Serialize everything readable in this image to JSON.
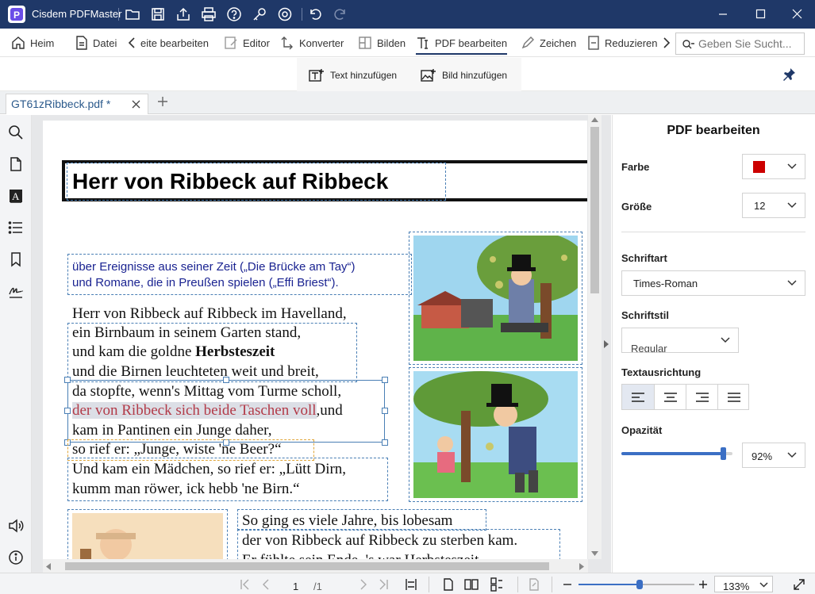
{
  "app": {
    "title": "Cisdem PDFMaster",
    "accent_color": "#1f3868"
  },
  "menu": {
    "home": "Heim",
    "file": "Datei",
    "edit_page": "eite bearbeiten",
    "editor": "Editor",
    "converter": "Konverter",
    "images": "Bilden",
    "edit_pdf": "PDF bearbeiten",
    "sign": "Zeichen",
    "reduce": "Reduzieren"
  },
  "search": {
    "placeholder": "Geben Sie Sucht..."
  },
  "subtoolbar": {
    "add_text": "Text hinzufügen",
    "add_image": "Bild hinzufügen"
  },
  "tab": {
    "filename": "GT61zRibbeck.pdf *"
  },
  "document": {
    "heading": "Herr von Ribbeck auf Ribbeck",
    "intro_line1": "über Ereignisse aus seiner Zeit („Die Brücke am Tay“)",
    "intro_line2": "und Romane, die in Preußen spielen („Effi Briest“).",
    "p1": "Herr von Ribbeck auf Ribbeck im Havelland,",
    "p2": "ein Birnbaum in seinem Garten stand,",
    "p3a": "und kam die goldne ",
    "p3b": "Herbsteszeit",
    "p4": "und die Birnen leuchteten weit und breit,",
    "p5": "da stopfte, wenn's Mittag vom Turme scholl,",
    "p6a": "der von Ribbeck sich beide Taschen voll",
    "p6b": ",und",
    "p7": "kam in Pantinen ein Junge daher,",
    "p8": "so rief er: „Junge, wiste 'ne Beer?“",
    "p9": "Und kam ein Mädchen, so rief er: „Lütt Dirn,",
    "p10": "kumm man röwer, ick hebb 'ne Birn.“",
    "p11": "So ging es viele Jahre, bis lobesam",
    "p12": "der von Ribbeck auf Ribbeck zu sterben kam.",
    "p13": "Er fühlte sein Ende. 's war Herbsteszeit,"
  },
  "panel": {
    "title": "PDF bearbeiten",
    "color_label": "Farbe",
    "color_value": "#cc0000",
    "size_label": "Größe",
    "size_value": "12",
    "font_label": "Schriftart",
    "font_value": "Times-Roman",
    "style_label": "Schriftstil",
    "style_value": "Regular",
    "align_label": "Textausrichtung",
    "opacity_label": "Opazität",
    "opacity_value": "92%",
    "opacity_fraction": 0.92
  },
  "status": {
    "page_current": "1",
    "page_total": "/1",
    "zoom": "133%",
    "zoom_fraction": 0.53
  }
}
